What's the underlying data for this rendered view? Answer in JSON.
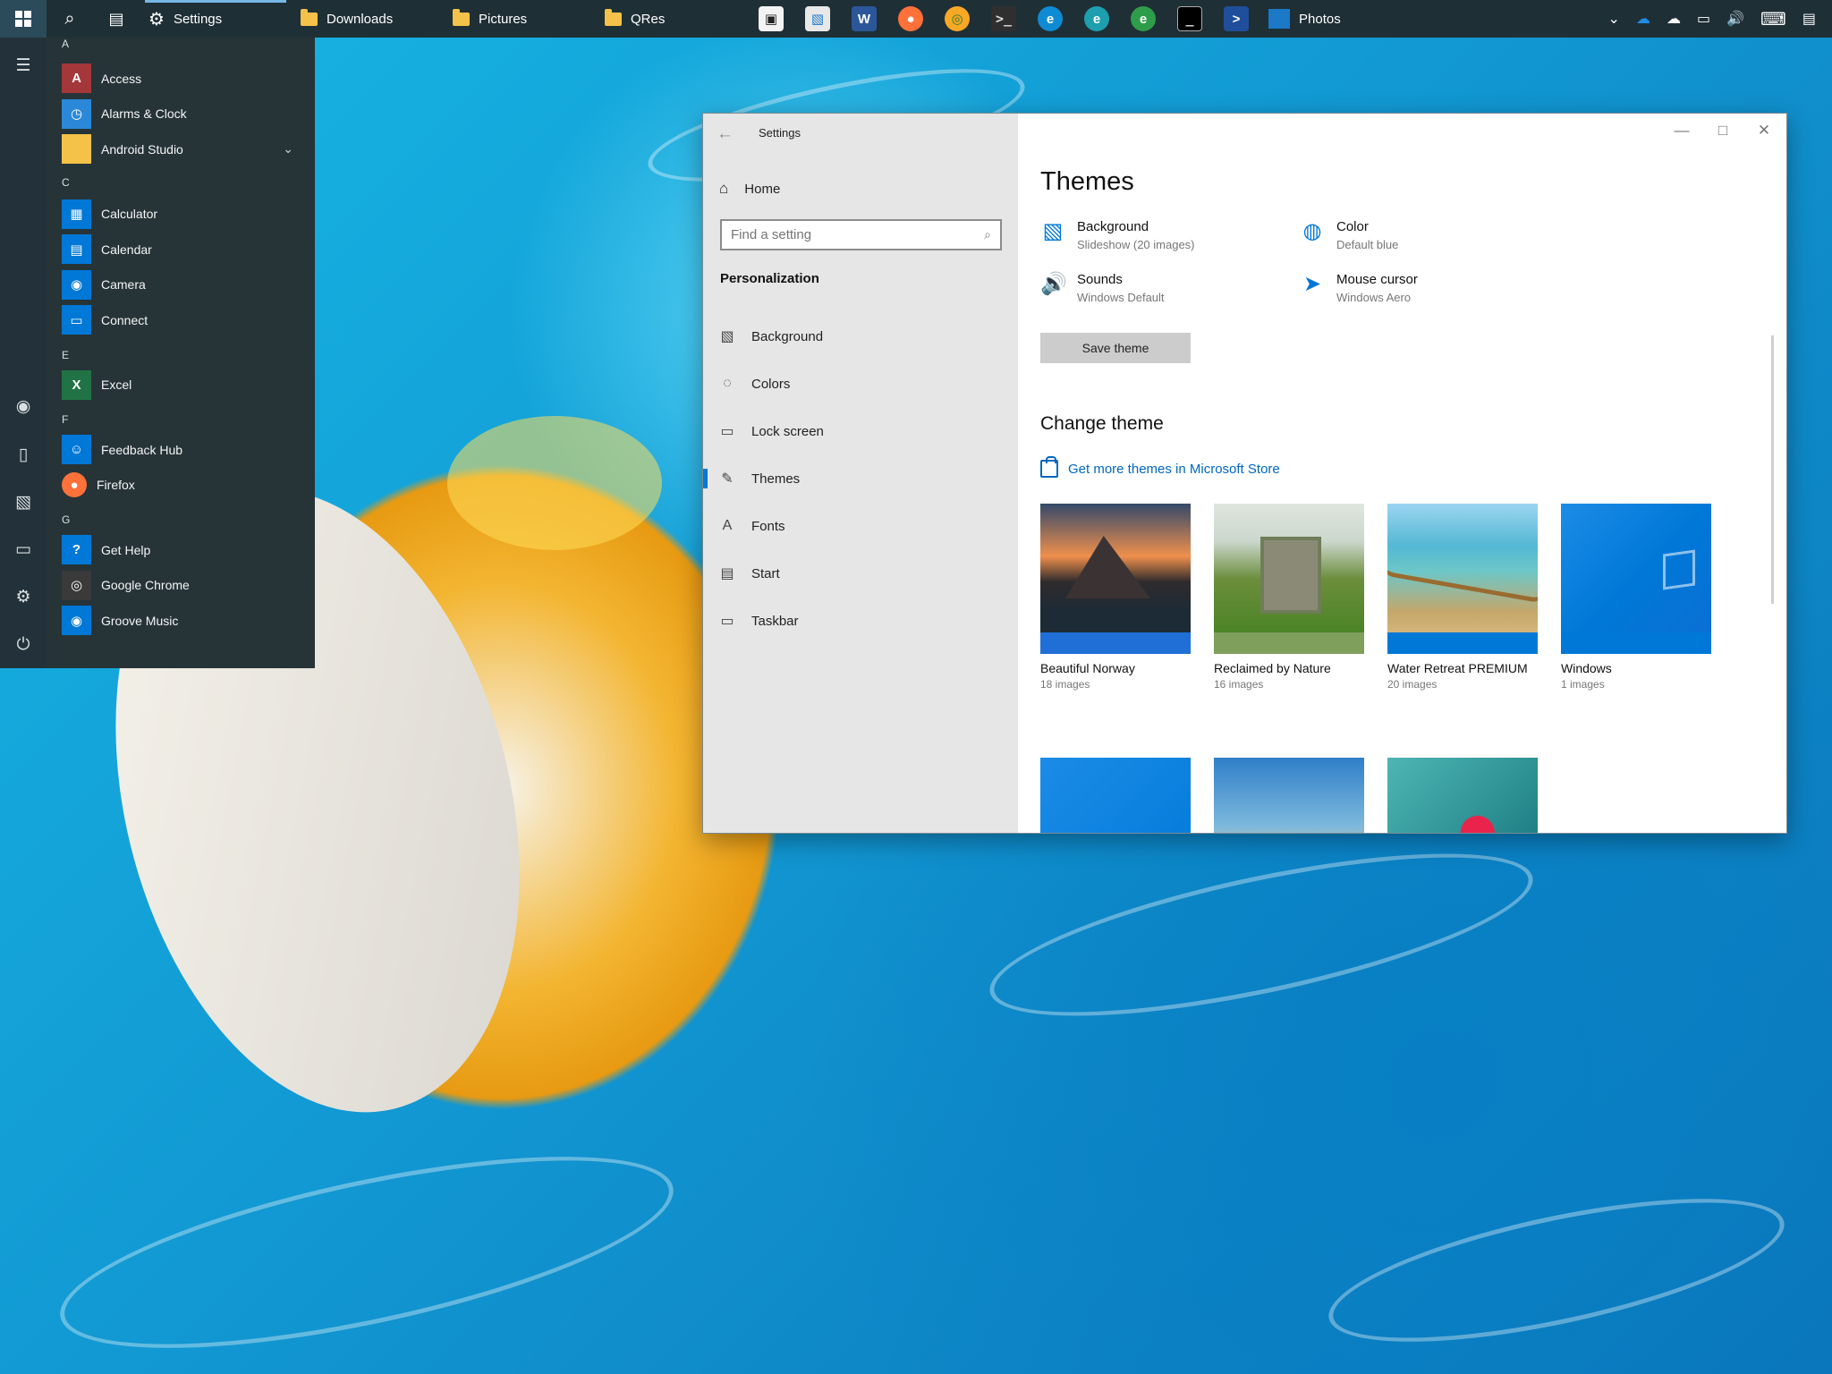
{
  "taskbar": {
    "tasks": [
      {
        "label": "Settings",
        "active": true
      },
      {
        "label": "Downloads",
        "active": false
      },
      {
        "label": "Pictures",
        "active": false
      },
      {
        "label": "QRes",
        "active": false
      }
    ],
    "pinned_apps": [
      "microsoft-store-icon",
      "photos-icon",
      "word-icon",
      "firefox-icon",
      "chrome-icon",
      "terminal-icon",
      "edge-beta-icon",
      "edge-dev-icon",
      "edge-canary-icon",
      "command-prompt-icon",
      "powershell-icon"
    ],
    "photos_label": "Photos",
    "tray_icons": [
      "chevron-up-icon",
      "onedrive-icon",
      "cloud-icon",
      "network-icon",
      "volume-icon",
      "keyboard-icon",
      "notification-icon"
    ]
  },
  "start_menu": {
    "groups": [
      {
        "letter": "A",
        "items": [
          {
            "name": "Access",
            "icon": "access-icon",
            "color": "#a4373a",
            "glyph": "A"
          },
          {
            "name": "Alarms & Clock",
            "icon": "clock-icon",
            "color": "#2b88d8",
            "glyph": "◷"
          },
          {
            "name": "Android Studio",
            "icon": "folder-icon",
            "color": "#f4c248",
            "glyph": "",
            "expandable": true
          }
        ]
      },
      {
        "letter": "C",
        "items": [
          {
            "name": "Calculator",
            "icon": "calculator-icon",
            "color": "#0078d7",
            "glyph": "▦"
          },
          {
            "name": "Calendar",
            "icon": "calendar-icon",
            "color": "#0078d7",
            "glyph": "▤"
          },
          {
            "name": "Camera",
            "icon": "camera-icon",
            "color": "#0078d7",
            "glyph": "◉"
          },
          {
            "name": "Connect",
            "icon": "connect-icon",
            "color": "#0078d7",
            "glyph": "▭"
          }
        ]
      },
      {
        "letter": "E",
        "items": [
          {
            "name": "Excel",
            "icon": "excel-icon",
            "color": "#217346",
            "glyph": "X"
          }
        ]
      },
      {
        "letter": "F",
        "items": [
          {
            "name": "Feedback Hub",
            "icon": "feedback-hub-icon",
            "color": "#0078d7",
            "glyph": "☺"
          },
          {
            "name": "Firefox",
            "icon": "firefox-icon",
            "color": "#263438",
            "glyph": "●"
          }
        ]
      },
      {
        "letter": "G",
        "items": [
          {
            "name": "Get Help",
            "icon": "get-help-icon",
            "color": "#0078d7",
            "glyph": "?"
          },
          {
            "name": "Google Chrome",
            "icon": "chrome-icon",
            "color": "#3a3a3a",
            "glyph": "◎"
          },
          {
            "name": "Groove Music",
            "icon": "groove-music-icon",
            "color": "#0078d7",
            "glyph": "◉"
          }
        ]
      }
    ]
  },
  "settings": {
    "window_title": "Settings",
    "home_label": "Home",
    "search_placeholder": "Find a setting",
    "section_title": "Personalization",
    "nav": [
      {
        "label": "Background",
        "icon": "image-icon",
        "glyph": "▧"
      },
      {
        "label": "Colors",
        "icon": "palette-icon",
        "glyph": "◌"
      },
      {
        "label": "Lock screen",
        "icon": "lock-screen-icon",
        "glyph": "▭"
      },
      {
        "label": "Themes",
        "icon": "themes-icon",
        "glyph": "✎",
        "selected": true
      },
      {
        "label": "Fonts",
        "icon": "fonts-icon",
        "glyph": "A"
      },
      {
        "label": "Start",
        "icon": "start-icon",
        "glyph": "▤"
      },
      {
        "label": "Taskbar",
        "icon": "taskbar-icon",
        "glyph": "▭"
      }
    ],
    "page_title": "Themes",
    "properties": [
      {
        "title": "Background",
        "value": "Slideshow (20 images)",
        "icon": "image-icon",
        "glyph": "▧"
      },
      {
        "title": "Color",
        "value": "Default blue",
        "icon": "palette-icon",
        "glyph": "◍"
      },
      {
        "title": "Sounds",
        "value": "Windows Default",
        "icon": "speaker-icon",
        "glyph": "🔊"
      },
      {
        "title": "Mouse cursor",
        "value": "Windows Aero",
        "icon": "cursor-icon",
        "glyph": "➤"
      }
    ],
    "save_theme_label": "Save theme",
    "change_theme_title": "Change theme",
    "store_link_label": "Get more themes in Microsoft Store",
    "themes": [
      {
        "name": "Beautiful Norway",
        "count": "18 images",
        "accent": "#1f6fd6"
      },
      {
        "name": "Reclaimed by Nature",
        "count": "16 images",
        "accent": "#7f9f5d"
      },
      {
        "name": "Water Retreat PREMIUM",
        "count": "20 images",
        "accent": "#0078d7"
      },
      {
        "name": "Windows",
        "count": "1 images",
        "accent": "#0078d7"
      }
    ],
    "accent_color": "#0078d7"
  }
}
